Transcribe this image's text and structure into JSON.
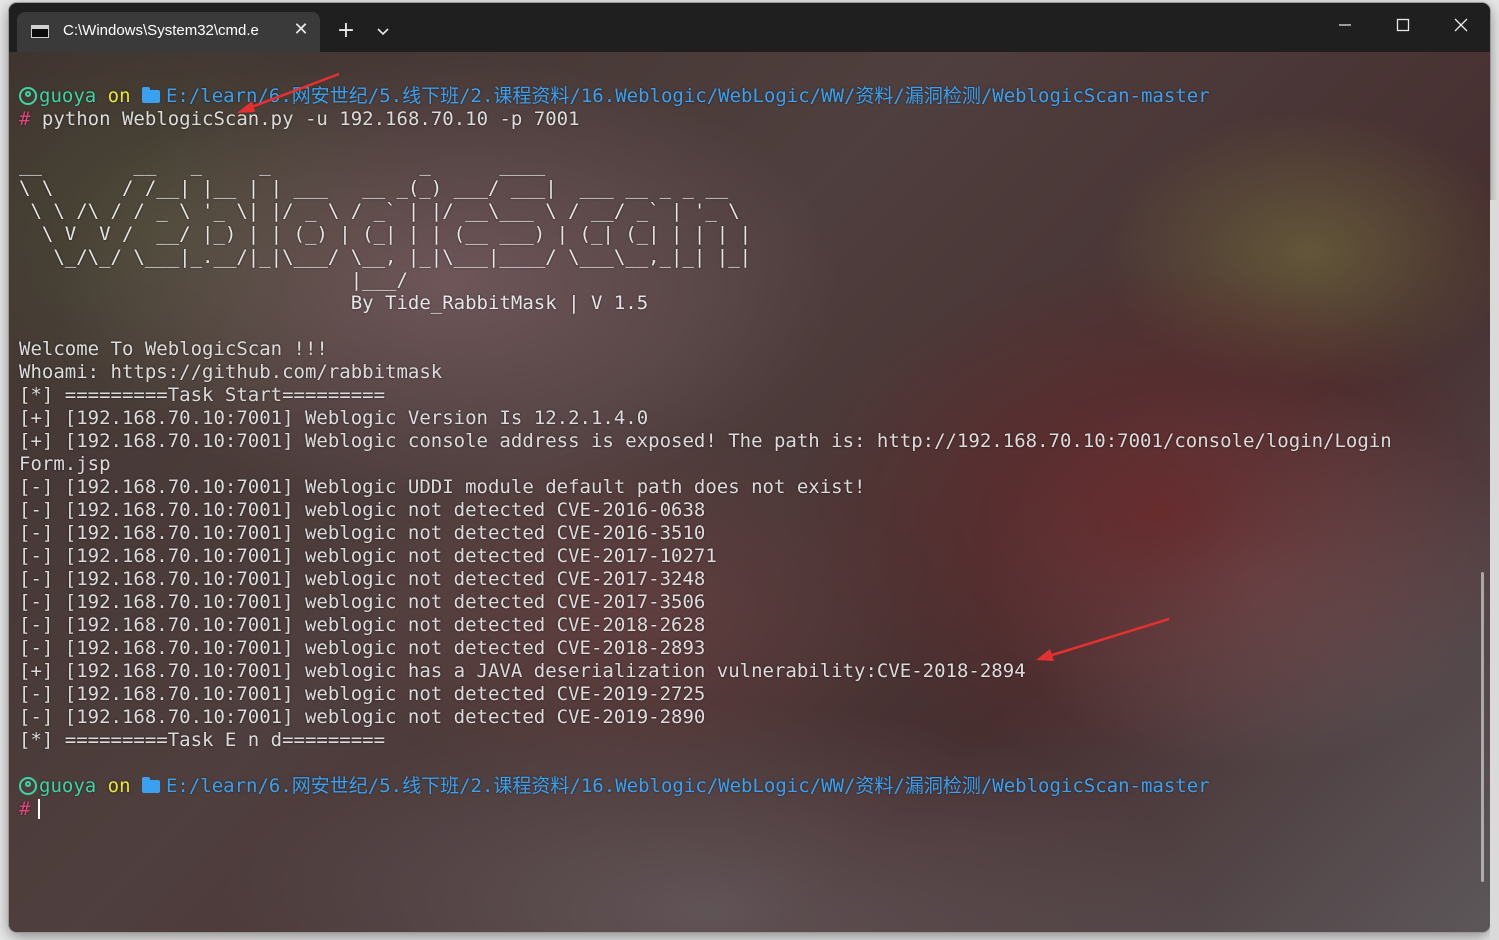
{
  "window": {
    "tab_title": "C:\\Windows\\System32\\cmd.e",
    "new_tab": "+"
  },
  "terminal": {
    "prompt1": {
      "user": "guoya",
      "on": " on ",
      "path": "E:/learn/6.网安世纪/5.线下班/2.课程资料/16.Weblogic/WebLogic/WW/资料/漏洞检测/WeblogicScan-master"
    },
    "command": {
      "hash": "#",
      "text": " python WeblogicScan.py -u 192.168.70.10 -p 7001"
    },
    "banner": [
      "__        __   _     _             _      ____",
      "\\ \\      / /__| |__ | | ___   __ _(_) ___/ ___|  ___ __ _ _ __",
      " \\ \\ /\\ / / _ \\ '_ \\| |/ _ \\ / _` | |/ __\\___ \\ / __/ _` | '_ \\",
      "  \\ V  V /  __/ |_) | | (_) | (_| | | (__ ___) | (_| (_| | | | |",
      "   \\_/\\_/ \\___|_.__/|_|\\___/ \\__, |_|\\___|____/ \\___\\__,_|_| |_|",
      "                             |___/",
      "                             By Tide_RabbitMask | V 1.5"
    ],
    "output": [
      "Welcome To WeblogicScan !!!",
      "Whoami: https://github.com/rabbitmask",
      "[*] =========Task Start=========",
      "[+] [192.168.70.10:7001] Weblogic Version Is 12.2.1.4.0",
      "[+] [192.168.70.10:7001] Weblogic console address is exposed! The path is: http://192.168.70.10:7001/console/login/Login",
      "Form.jsp",
      "[-] [192.168.70.10:7001] Weblogic UDDI module default path does not exist!",
      "[-] [192.168.70.10:7001] weblogic not detected CVE-2016-0638",
      "[-] [192.168.70.10:7001] weblogic not detected CVE-2016-3510",
      "[-] [192.168.70.10:7001] weblogic not detected CVE-2017-10271",
      "[-] [192.168.70.10:7001] weblogic not detected CVE-2017-3248",
      "[-] [192.168.70.10:7001] weblogic not detected CVE-2017-3506",
      "[-] [192.168.70.10:7001] weblogic not detected CVE-2018-2628",
      "[-] [192.168.70.10:7001] weblogic not detected CVE-2018-2893",
      "[+] [192.168.70.10:7001] weblogic has a JAVA deserialization vulnerability:CVE-2018-2894",
      "[-] [192.168.70.10:7001] weblogic not detected CVE-2019-2725",
      "[-] [192.168.70.10:7001] weblogic not detected CVE-2019-2890",
      "[*] =========Task E n d========="
    ],
    "prompt2": {
      "user": "guoya",
      "on": " on ",
      "path": "E:/learn/6.网安世纪/5.线下班/2.课程资料/16.Weblogic/WebLogic/WW/资料/漏洞检测/WeblogicScan-master",
      "hash": "#"
    }
  },
  "colors": {
    "user": "#3fd4a4",
    "path": "#3aa0f0",
    "hash": "#e0457b",
    "annotation_arrow": "#e53030"
  },
  "icons": {
    "tab": "terminal-icon",
    "prompt_user": "user-circle-icon",
    "prompt_folder": "folder-icon",
    "minimize": "minimize-icon",
    "maximize": "maximize-icon",
    "close": "close-icon",
    "dropdown": "chevron-down-icon"
  }
}
